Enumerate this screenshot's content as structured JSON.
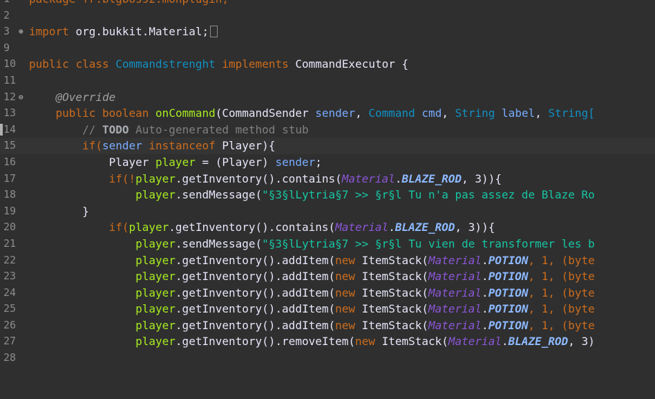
{
  "editor": {
    "lines": [
      {
        "num": "1",
        "tokens": [
          "package fr.blgboss2.monplugin;"
        ]
      },
      {
        "num": "2",
        "tokens": []
      },
      {
        "num": "3",
        "tokens": [
          "import",
          "org.bukkit.Material;"
        ]
      },
      {
        "num": "9",
        "tokens": []
      },
      {
        "num": "10",
        "tokens": [
          "public",
          "class",
          "Commandstrenght",
          "implements",
          "CommandExecutor",
          "{"
        ]
      },
      {
        "num": "11",
        "tokens": []
      },
      {
        "num": "12",
        "tokens": [
          "@Override"
        ]
      },
      {
        "num": "13",
        "tokens": [
          "public",
          "boolean",
          "onCommand",
          "(",
          "CommandSender",
          "sender",
          ",",
          "Command",
          "cmd",
          ",",
          "String",
          "label",
          ",",
          "String["
        ]
      },
      {
        "num": "14",
        "tokens": [
          "//",
          "TODO",
          "Auto-generated method stub"
        ]
      },
      {
        "num": "15",
        "tokens": [
          "if(",
          "sender",
          "instanceof",
          "Player){"
        ]
      },
      {
        "num": "16",
        "tokens": [
          "Player",
          "player",
          "= (Player)",
          "sender",
          ";"
        ]
      },
      {
        "num": "17",
        "tokens": [
          "if(!",
          "player",
          ".getInventory().contains(",
          "Material",
          ".",
          "BLAZE_ROD",
          ", 3)){"
        ]
      },
      {
        "num": "18",
        "tokens": [
          "player",
          ".sendMessage(",
          "\"§3§lLytria§7 >> §r§l Tu n'a pas assez de Blaze Ro"
        ]
      },
      {
        "num": "19",
        "tokens": [
          "}"
        ]
      },
      {
        "num": "20",
        "tokens": [
          "if(",
          "player",
          ".getInventory().contains(",
          "Material",
          ".",
          "BLAZE_ROD",
          ", 3)){"
        ]
      },
      {
        "num": "21",
        "tokens": [
          "player",
          ".sendMessage(",
          "\"§3§lLytria§7 >> §r§l Tu vien de transformer les b"
        ]
      },
      {
        "num": "22",
        "tokens": [
          "player",
          ".getInventory().addItem(",
          "new",
          "ItemStack(",
          "Material",
          ".",
          "POTION",
          ", 1, (byte"
        ]
      },
      {
        "num": "23",
        "tokens": [
          "player",
          ".getInventory().addItem(",
          "new",
          "ItemStack(",
          "Material",
          ".",
          "POTION",
          ", 1, (byte"
        ]
      },
      {
        "num": "24",
        "tokens": [
          "player",
          ".getInventory().addItem(",
          "new",
          "ItemStack(",
          "Material",
          ".",
          "POTION",
          ", 1, (byte"
        ]
      },
      {
        "num": "25",
        "tokens": [
          "player",
          ".getInventory().addItem(",
          "new",
          "ItemStack(",
          "Material",
          ".",
          "POTION",
          ", 1, (byte"
        ]
      },
      {
        "num": "26",
        "tokens": [
          "player",
          ".getInventory().addItem(",
          "new",
          "ItemStack(",
          "Material",
          ".",
          "POTION",
          ", 1, (byte"
        ]
      },
      {
        "num": "27",
        "tokens": [
          "player",
          ".getInventory().removeItem(",
          "new",
          "ItemStack(",
          "Material",
          ".",
          "BLAZE_ROD",
          ", 3)"
        ]
      },
      {
        "num": "28",
        "tokens": []
      }
    ]
  }
}
